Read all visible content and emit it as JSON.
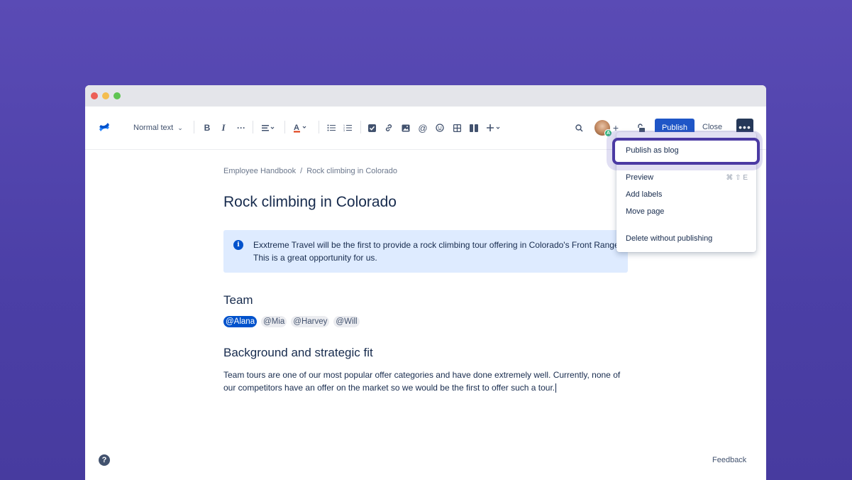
{
  "toolbar": {
    "text_style": "Normal text",
    "publish_label": "Publish",
    "close_label": "Close",
    "avatar_badge": "A"
  },
  "breadcrumb": {
    "parent": "Employee Handbook",
    "separator": "/",
    "current": "Rock climbing in Colorado"
  },
  "page": {
    "title": "Rock climbing in Colorado",
    "info_text": "Exxtreme Travel will be the first to provide a rock climbing tour offering in Colorado's Front Range. This is a great opportunity for us.",
    "team_heading": "Team",
    "mentions": [
      "@Alana",
      "@Mia",
      "@Harvey",
      "@Will"
    ],
    "bg_heading": "Background and strategic fit",
    "bg_text": "Team tours are one of our most popular offer categories and have done extremely well. Currently, none of our competitors have an offer on the market so we would be the first to offer such a tour."
  },
  "menu": {
    "publish_blog": "Publish as blog",
    "preview": "Preview",
    "preview_shortcut": "⌘ ⇧ E",
    "add_labels": "Add labels",
    "move_page": "Move page",
    "delete": "Delete without publishing"
  },
  "footer": {
    "feedback": "Feedback",
    "help": "?"
  },
  "colors": {
    "accent": "#1f56c7",
    "highlight": "#4b3aa3",
    "background": "#5a4bb5"
  }
}
